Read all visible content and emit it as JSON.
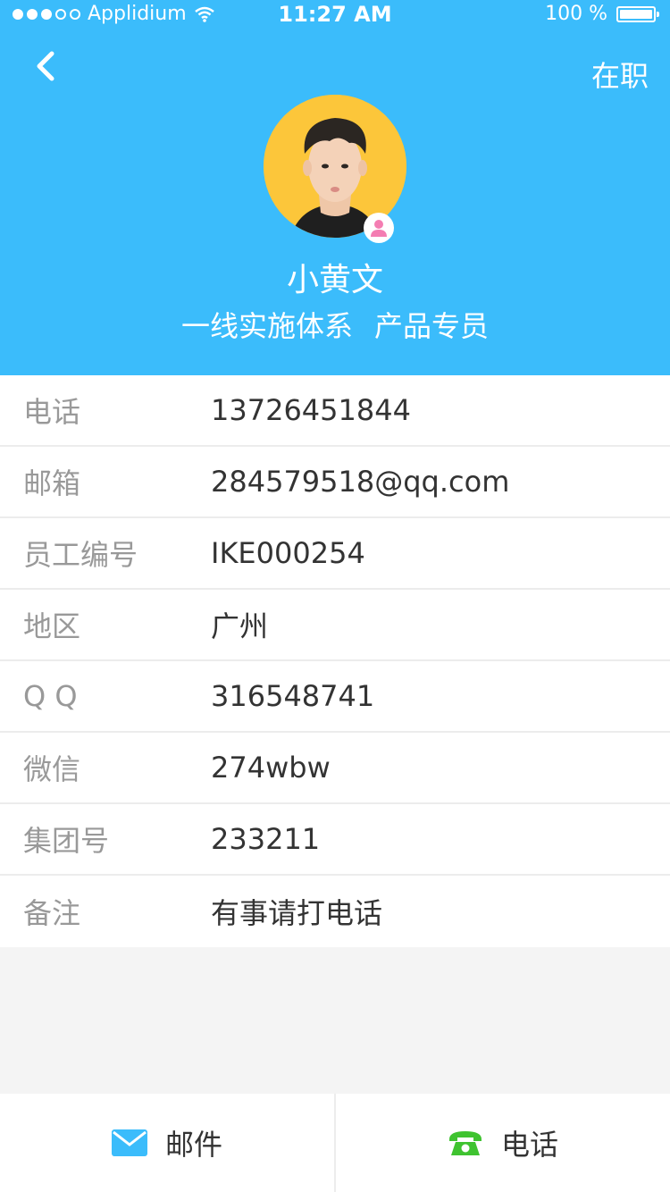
{
  "status_bar": {
    "carrier": "Applidium",
    "time": "11:27 AM",
    "battery": "100 %"
  },
  "header": {
    "status": "在职",
    "name": "小黄文",
    "department": "一线实施体系",
    "title": "产品专员"
  },
  "fields": [
    {
      "label": "电话",
      "value": "13726451844"
    },
    {
      "label": "邮箱",
      "value": "284579518@qq.com"
    },
    {
      "label": "员工编号",
      "value": "IKE000254"
    },
    {
      "label": "地区",
      "value": "广州"
    },
    {
      "label": "Q Q",
      "value": "316548741"
    },
    {
      "label": "微信",
      "value": "274wbw"
    },
    {
      "label": "集团号",
      "value": "233211"
    },
    {
      "label": "备注",
      "value": "有事请打电话"
    }
  ],
  "actions": {
    "mail": "邮件",
    "phone": "电话"
  },
  "colors": {
    "header_bg": "#3bbcfb",
    "label": "#999999",
    "value": "#333333",
    "mail_icon": "#3bbcfb",
    "phone_icon": "#3fc330"
  }
}
